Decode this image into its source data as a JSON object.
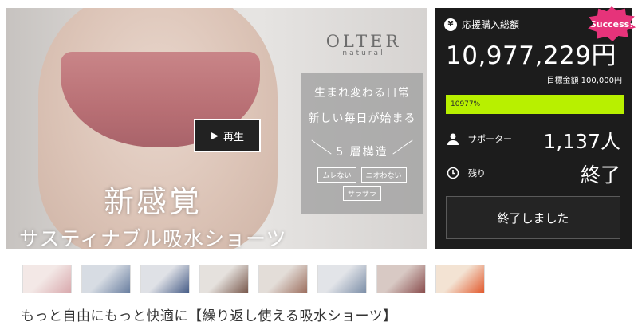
{
  "hero": {
    "brand": "OLTER",
    "brand_sub": "natural",
    "panel_line1": "生まれ変わる日常",
    "panel_line2": "新しい毎日が始まる",
    "panel_line3": "5 層構造",
    "tags": [
      "ムレない",
      "ニオわない",
      "サラサラ"
    ],
    "play_label": "再生",
    "headline": "新感覚",
    "subheadline": "サスティナブル吸水ショーツ"
  },
  "sidebar": {
    "amount_label": "応援購入総額",
    "amount": "10,977,229円",
    "goal_text": "目標金額 100,000円",
    "progress_label": "10977%",
    "progress_value": 1.0,
    "supporters_label": "サポーター",
    "supporters_value": "1,137人",
    "remaining_label": "残り",
    "remaining_value": "終了",
    "ended_button": "終了しました",
    "badge": "Success!"
  },
  "colors": {
    "accent_progress": "#b8f000",
    "badge": "#e6337a",
    "panel_bg": "#1c1c1c"
  },
  "thumbnails": [
    {
      "name": "thumb-pink-shorts",
      "colors": [
        "#f3e8e6",
        "#d9a9ad"
      ]
    },
    {
      "name": "thumb-group-models-1",
      "colors": [
        "#d7dce3",
        "#6a7fa0"
      ]
    },
    {
      "name": "thumb-group-models-2",
      "colors": [
        "#dfe1e6",
        "#485e88"
      ]
    },
    {
      "name": "thumb-models-3",
      "colors": [
        "#e5e1dd",
        "#7a5a4e"
      ]
    },
    {
      "name": "thumb-models-4",
      "colors": [
        "#e3ddd8",
        "#9d7060"
      ]
    },
    {
      "name": "thumb-models-5",
      "colors": [
        "#e2e4e8",
        "#7d8fa8"
      ]
    },
    {
      "name": "thumb-models-6",
      "colors": [
        "#d8c9c4",
        "#8a4e4e"
      ]
    },
    {
      "name": "thumb-campaign",
      "colors": [
        "#f3e3d3",
        "#e25b2f"
      ]
    }
  ],
  "page": {
    "title": "もっと自由にもっと快適に【繰り返し使える吸水ショーツ】"
  }
}
